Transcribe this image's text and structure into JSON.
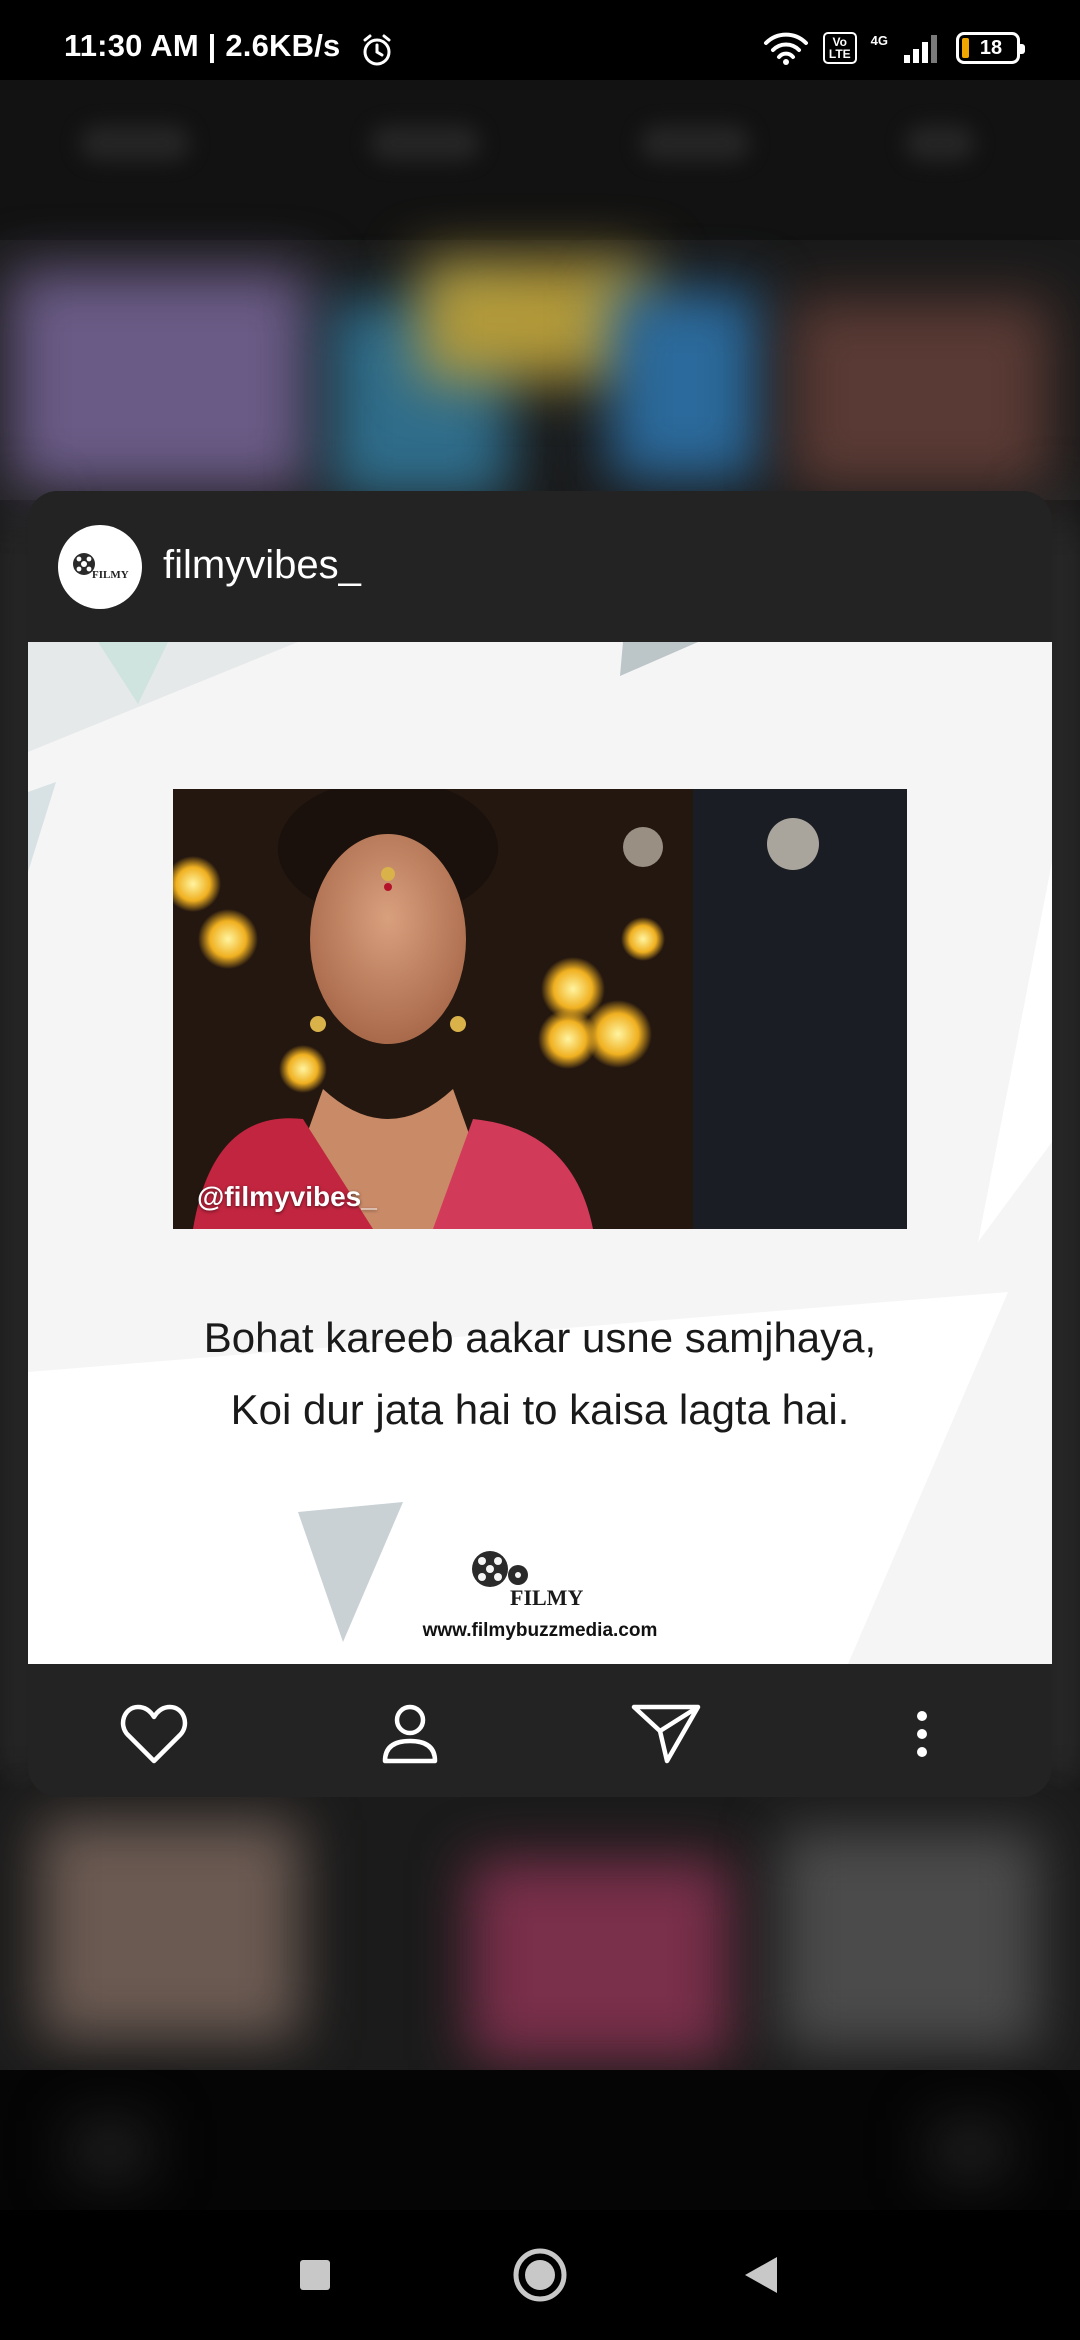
{
  "status_bar": {
    "time": "11:30 AM | 2.6KB/s",
    "volte_line1": "Vo",
    "volte_line2": "LTE",
    "network": "4G",
    "battery_level": "18"
  },
  "card": {
    "username": "filmyvibes_",
    "avatar_logo_text": "FILMY",
    "photo_watermark": "@filmyvibes_",
    "quote_line1": "Bohat kareeb aakar usne samjhaya,",
    "quote_line2": "Koi dur jata hai to kaisa lagta hai.",
    "brand_logo_text": "FILMY",
    "brand_url": "www.filmybuzzmedia.com"
  },
  "actions": [
    "heart-icon",
    "person-icon",
    "send-icon",
    "more-vertical-icon"
  ],
  "nav": [
    "recents-button",
    "home-button",
    "back-button"
  ],
  "colors": {
    "card_bar": "#232323",
    "post_background": "#f5f5f5",
    "accent_triangles": "#c9d3d6"
  }
}
